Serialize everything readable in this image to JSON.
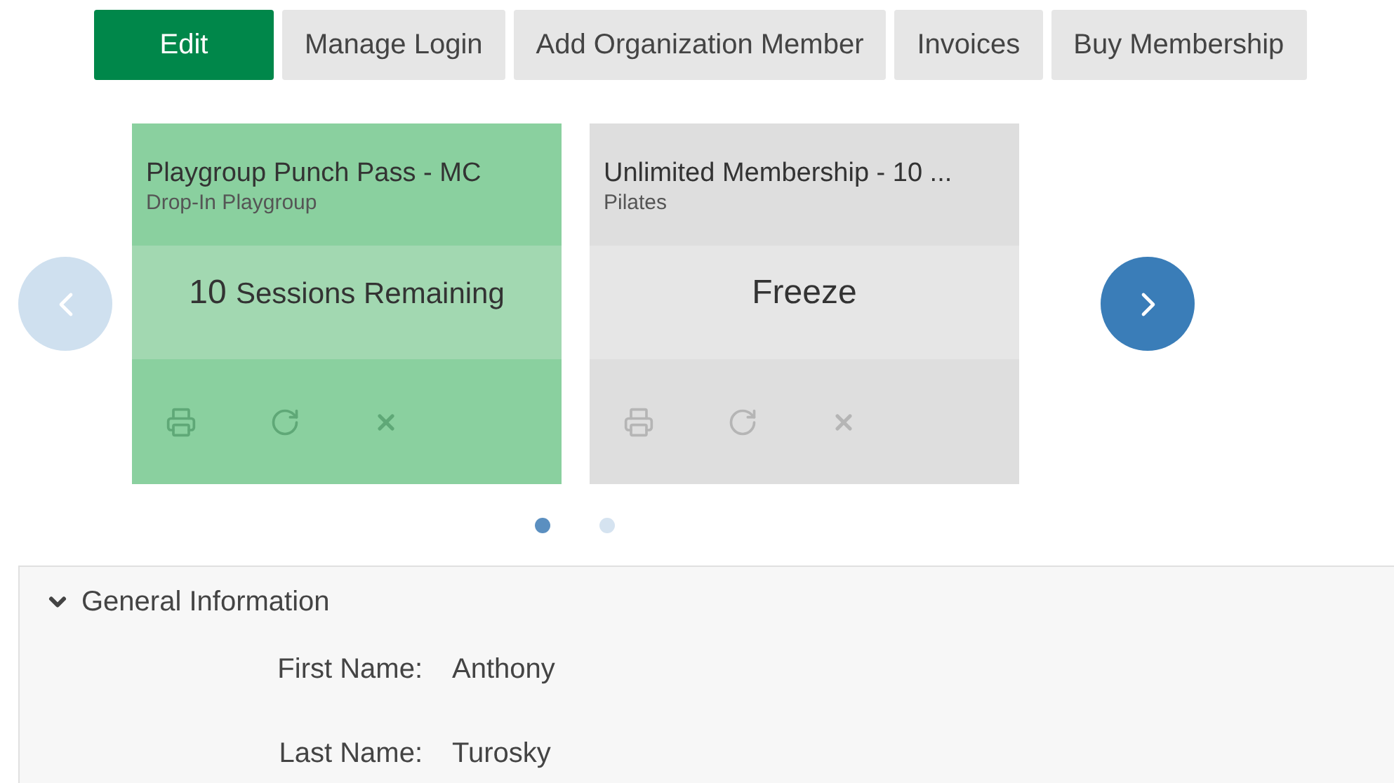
{
  "actions": [
    {
      "label": "Edit",
      "kind": "primary"
    },
    {
      "label": "Manage Login",
      "kind": "secondary"
    },
    {
      "label": "Add Organization Member",
      "kind": "secondary"
    },
    {
      "label": "Invoices",
      "kind": "secondary"
    },
    {
      "label": "Buy Membership",
      "kind": "secondary"
    }
  ],
  "carousel": {
    "prev_disabled": true,
    "next_disabled": false,
    "cards": [
      {
        "title": "Playgroup Punch Pass - MC",
        "subtitle": "Drop-In Playgroup",
        "count": "10",
        "status": "Sessions Remaining",
        "active": true
      },
      {
        "title": "Unlimited Membership - 10 ...",
        "subtitle": "Pilates",
        "status": "Freeze",
        "active": false
      }
    ],
    "pages": [
      {
        "selected": true
      },
      {
        "selected": false
      }
    ]
  },
  "general_information": {
    "title": "General Information",
    "expanded": true,
    "fields": [
      {
        "label": "First Name:",
        "value": "Anthony"
      },
      {
        "label": "Last Name:",
        "value": "Turosky"
      }
    ]
  }
}
